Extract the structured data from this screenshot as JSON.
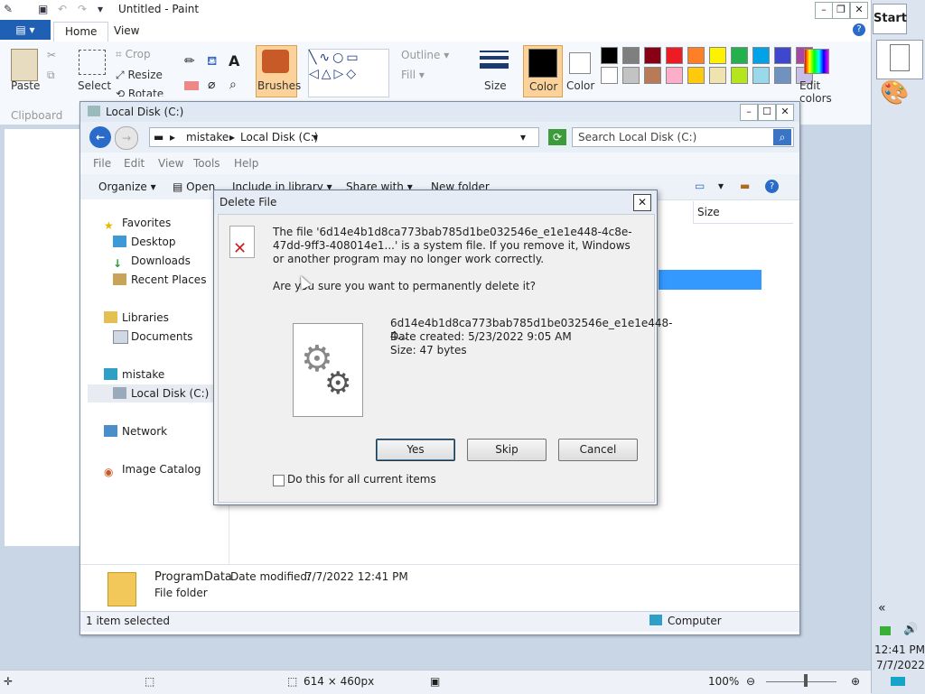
{
  "paint": {
    "title": "Untitled - Paint",
    "tabs": [
      "Home",
      "View"
    ],
    "clipboard": {
      "paste": "Paste",
      "group": "Clipboard"
    },
    "image": {
      "select": "Select",
      "crop": "Crop",
      "resize": "Resize",
      "rotate": "Rotate"
    },
    "brushes": "Brushes",
    "shapes": {
      "outline": "Outline",
      "fill": "Fill"
    },
    "size": "Size",
    "color1": "Color",
    "color2": "Color",
    "edit_colors": "Edit colors",
    "palette_row1": [
      "#000000",
      "#7f7f7f",
      "#880015",
      "#ed1c24",
      "#ff7f27",
      "#fff200",
      "#22b14c",
      "#00a2e8",
      "#3f48cc",
      "#a349a4"
    ],
    "palette_row2": [
      "#ffffff",
      "#c3c3c3",
      "#b97a57",
      "#ffaec9",
      "#ffc90e",
      "#efe4b0",
      "#b5e61d",
      "#99d9ea",
      "#7092be",
      "#c8bfe7"
    ],
    "status": {
      "dimensions": "614 × 460px",
      "zoom": "100%"
    }
  },
  "explorer": {
    "title": "Local Disk (C:)",
    "breadcrumb": [
      "mistake",
      "Local Disk (C:)"
    ],
    "search_placeholder": "Search Local Disk (C:)",
    "menu": [
      "File",
      "Edit",
      "View",
      "Tools",
      "Help"
    ],
    "commands": {
      "organize": "Organize",
      "open": "Open",
      "include": "Include in library",
      "share": "Share with",
      "new_folder": "New folder"
    },
    "column_size": "Size",
    "nav": {
      "favorites": "Favorites",
      "desktop": "Desktop",
      "downloads": "Downloads",
      "recent": "Recent Places",
      "libraries": "Libraries",
      "documents": "Documents",
      "computer": "mistake",
      "local_disk": "Local Disk (C:)",
      "network": "Network",
      "image_catalog": "Image Catalog"
    },
    "details": {
      "name": "ProgramData",
      "modified_label": "Date modified:",
      "modified": "7/7/2022 12:41 PM",
      "type": "File folder"
    },
    "status": {
      "selected": "1 item selected",
      "location": "Computer"
    }
  },
  "dialog": {
    "title": "Delete File",
    "message": "The file '6d14e4b1d8ca773bab785d1be032546e_e1e1e448-4c8e-47dd-9ff3-408014e1...' is a system file. If you remove it, Windows or another program may no longer work correctly.",
    "question": "Are you sure you want to permanently delete it?",
    "file_name": "6d14e4b1d8ca773bab785d1be032546e_e1e1e448-4...",
    "date_created": "Date created: 5/23/2022 9:05 AM",
    "size": "Size: 47 bytes",
    "yes": "Yes",
    "skip": "Skip",
    "cancel": "Cancel",
    "apply_all": "Do this for all current items"
  },
  "taskbar": {
    "start": "Start",
    "time": "12:41 PM",
    "date": "7/7/2022"
  }
}
